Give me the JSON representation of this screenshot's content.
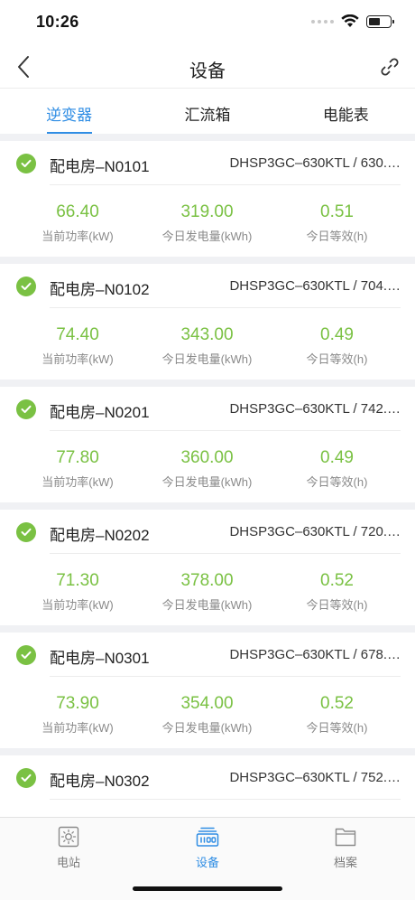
{
  "status_bar": {
    "time": "10:26"
  },
  "nav": {
    "title": "设备",
    "back_icon": "chevron-left-icon",
    "action_icon": "link-icon"
  },
  "tabs": [
    {
      "label": "逆变器",
      "active": true
    },
    {
      "label": "汇流箱",
      "active": false
    },
    {
      "label": "电能表",
      "active": false
    }
  ],
  "metric_labels": {
    "power": "当前功率(kW)",
    "energy": "今日发电量(kWh)",
    "hours": "今日等效(h)"
  },
  "devices": [
    {
      "name": "配电房–N0101",
      "model": "DHSP3GC–630KTL / 630.…",
      "status": "normal",
      "power": "66.40",
      "energy": "319.00",
      "hours": "0.51"
    },
    {
      "name": "配电房–N0102",
      "model": "DHSP3GC–630KTL / 704.…",
      "status": "normal",
      "power": "74.40",
      "energy": "343.00",
      "hours": "0.49"
    },
    {
      "name": "配电房–N0201",
      "model": "DHSP3GC–630KTL / 742.…",
      "status": "normal",
      "power": "77.80",
      "energy": "360.00",
      "hours": "0.49"
    },
    {
      "name": "配电房–N0202",
      "model": "DHSP3GC–630KTL / 720.…",
      "status": "normal",
      "power": "71.30",
      "energy": "378.00",
      "hours": "0.52"
    },
    {
      "name": "配电房–N0301",
      "model": "DHSP3GC–630KTL / 678.…",
      "status": "normal",
      "power": "73.90",
      "energy": "354.00",
      "hours": "0.52"
    },
    {
      "name": "配电房–N0302",
      "model": "DHSP3GC–630KTL / 752.…",
      "status": "normal",
      "power": "",
      "energy": "",
      "hours": ""
    }
  ],
  "bottom_tabs": [
    {
      "label": "电站",
      "icon": "sun-icon",
      "active": false
    },
    {
      "label": "设备",
      "icon": "device-icon",
      "active": true
    },
    {
      "label": "档案",
      "icon": "folder-icon",
      "active": false
    }
  ],
  "colors": {
    "accent": "#2f8de4",
    "ok_green": "#7ac143",
    "value_green": "#7ac143"
  }
}
